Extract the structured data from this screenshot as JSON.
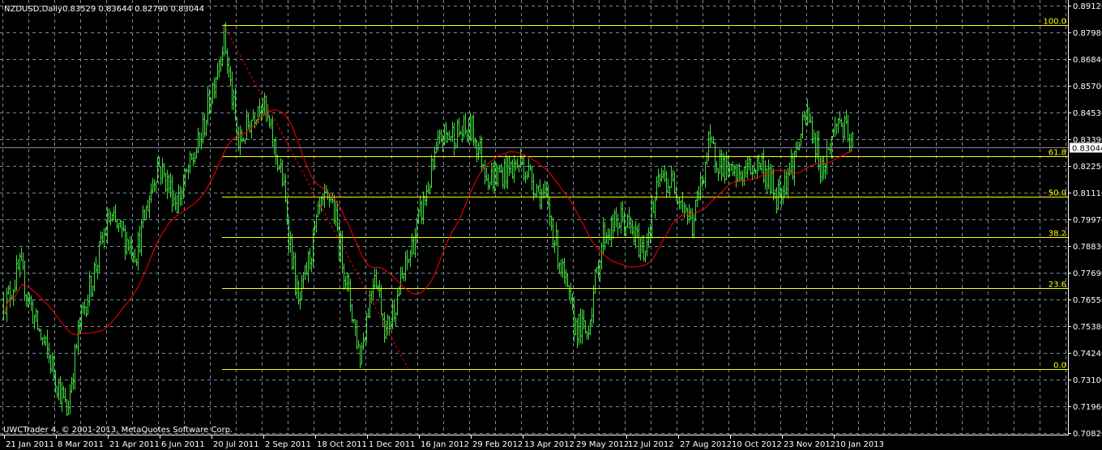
{
  "header": {
    "symbol_timeframe": "NZDUSD,Daily",
    "ohlc": "0.83529 0.83644 0.82790 0.83044"
  },
  "footer": {
    "copyright": "UWCTrader 4, © 2001-2013, MetaQuotes Software Corp."
  },
  "colors": {
    "background": "#000000",
    "bars": "#3ee03e",
    "grid": "#7a8a9a",
    "fibo": "#ffff00",
    "ma": "#ff0000",
    "trendline": "#ff0000",
    "axis": "#ffffff"
  },
  "chart_data": {
    "type": "ohlc",
    "symbol": "NZDUSD",
    "timeframe": "Daily",
    "ylim": [
      0.7082,
      0.8912
    ],
    "y_ticks": [
      "0.89120",
      "0.87980",
      "0.86840",
      "0.85700",
      "0.84530",
      "0.83390",
      "0.82250",
      "0.81110",
      "0.79970",
      "0.78830",
      "0.77690",
      "0.76550",
      "0.75380",
      "0.74240",
      "0.73100",
      "0.71960",
      "0.70820"
    ],
    "x_ticks": [
      {
        "label": "21 Jan 2011",
        "bar": 1
      },
      {
        "label": "8 Mar 2011",
        "bar": 33
      },
      {
        "label": "21 Apr 2011",
        "bar": 65
      },
      {
        "label": "6 Jun 2011",
        "bar": 97
      },
      {
        "label": "20 Jul 2011",
        "bar": 129
      },
      {
        "label": "2 Sep 2011",
        "bar": 161
      },
      {
        "label": "18 Oct 2011",
        "bar": 193
      },
      {
        "label": "1 Dec 2011",
        "bar": 225
      },
      {
        "label": "16 Jan 2012",
        "bar": 257
      },
      {
        "label": "29 Feb 2012",
        "bar": 289
      },
      {
        "label": "13 Apr 2012",
        "bar": 321
      },
      {
        "label": "29 May 2012",
        "bar": 353
      },
      {
        "label": "12 Jul 2012",
        "bar": 385
      },
      {
        "label": "27 Aug 2012",
        "bar": 417
      },
      {
        "label": "10 Oct 2012",
        "bar": 449
      },
      {
        "label": "23 Nov 2012",
        "bar": 481
      },
      {
        "label": "10 Jan 2013",
        "bar": 513
      }
    ],
    "bar_count": 525,
    "price_path": [
      [
        2,
        0.765
      ],
      [
        10,
        0.779
      ],
      [
        20,
        0.755
      ],
      [
        30,
        0.737
      ],
      [
        39,
        0.717
      ],
      [
        47,
        0.755
      ],
      [
        65,
        0.8
      ],
      [
        82,
        0.786
      ],
      [
        95,
        0.824
      ],
      [
        107,
        0.807
      ],
      [
        122,
        0.835
      ],
      [
        136,
        0.878
      ],
      [
        145,
        0.831
      ],
      [
        159,
        0.852
      ],
      [
        172,
        0.817
      ],
      [
        182,
        0.762
      ],
      [
        195,
        0.803
      ],
      [
        202,
        0.81
      ],
      [
        220,
        0.741
      ],
      [
        229,
        0.779
      ],
      [
        236,
        0.751
      ],
      [
        250,
        0.783
      ],
      [
        270,
        0.835
      ],
      [
        289,
        0.838
      ],
      [
        300,
        0.817
      ],
      [
        320,
        0.824
      ],
      [
        335,
        0.807
      ],
      [
        352,
        0.755
      ],
      [
        360,
        0.751
      ],
      [
        370,
        0.793
      ],
      [
        382,
        0.8
      ],
      [
        395,
        0.786
      ],
      [
        405,
        0.817
      ],
      [
        415,
        0.814
      ],
      [
        425,
        0.797
      ],
      [
        435,
        0.831
      ],
      [
        450,
        0.817
      ],
      [
        467,
        0.824
      ],
      [
        477,
        0.81
      ],
      [
        487,
        0.824
      ],
      [
        496,
        0.845
      ],
      [
        505,
        0.821
      ],
      [
        515,
        0.843
      ],
      [
        524,
        0.83044
      ]
    ],
    "current_price": "0.83044",
    "moving_average": {
      "type": "SMA",
      "period": 50
    },
    "fibonacci": {
      "high": 0.883,
      "low": 0.7356,
      "start_bar": 135,
      "levels": [
        {
          "label": "100.0",
          "ratio": 1.0
        },
        {
          "label": "61.8",
          "ratio": 0.618
        },
        {
          "label": "50.0",
          "ratio": 0.5
        },
        {
          "label": "38.2",
          "ratio": 0.382
        },
        {
          "label": "23.6",
          "ratio": 0.236
        },
        {
          "label": "0.0",
          "ratio": 0.0
        }
      ]
    },
    "trendline": {
      "from": {
        "bar": 136,
        "price": 0.883
      },
      "to": {
        "bar": 250,
        "price": 0.7356
      },
      "style": "dashed"
    }
  }
}
